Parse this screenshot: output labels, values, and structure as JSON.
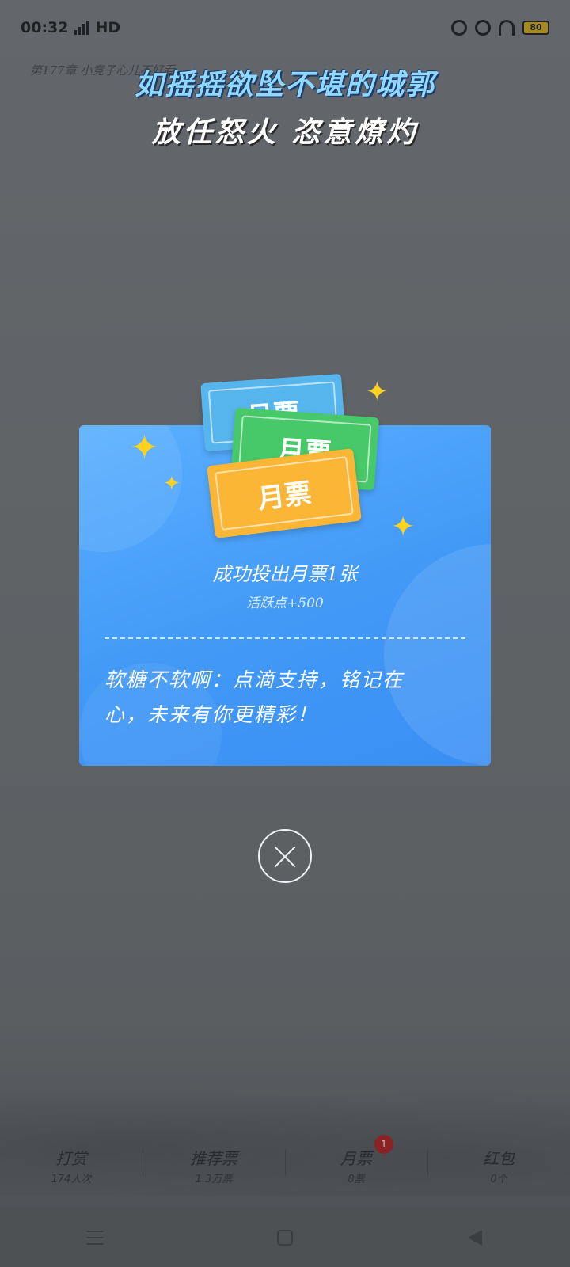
{
  "status_bar": {
    "time": "00:32",
    "network": "HD",
    "battery": "80"
  },
  "background": {
    "chapter_text": "第177章 小竞子心儿不好看",
    "slogan_line1": "如摇摇欲坠不堪的城郭",
    "slogan_line2": "放任怒火 恣意燎灼"
  },
  "tickets": {
    "blue_label": "月票",
    "green_label": "月票",
    "yellow_label": "月票"
  },
  "dialog": {
    "success_text": "成功投出月票1张",
    "points_text": "活跃点+500",
    "thanks_text": "软糖不软啊：点滴支持，铭记在心，未来有你更精彩！"
  },
  "actions": [
    {
      "label": "打赏",
      "count": "174人次"
    },
    {
      "label": "推荐票",
      "count": "1.3万票"
    },
    {
      "label": "月票",
      "count": "8票",
      "badge": "1"
    },
    {
      "label": "红包",
      "count": "0个"
    }
  ],
  "colors": {
    "card_blue": "#4299f6",
    "ticket_blue": "#57b5ee",
    "ticket_green": "#47c96a",
    "ticket_yellow": "#fbb636",
    "sparkle": "#ffd21f"
  }
}
